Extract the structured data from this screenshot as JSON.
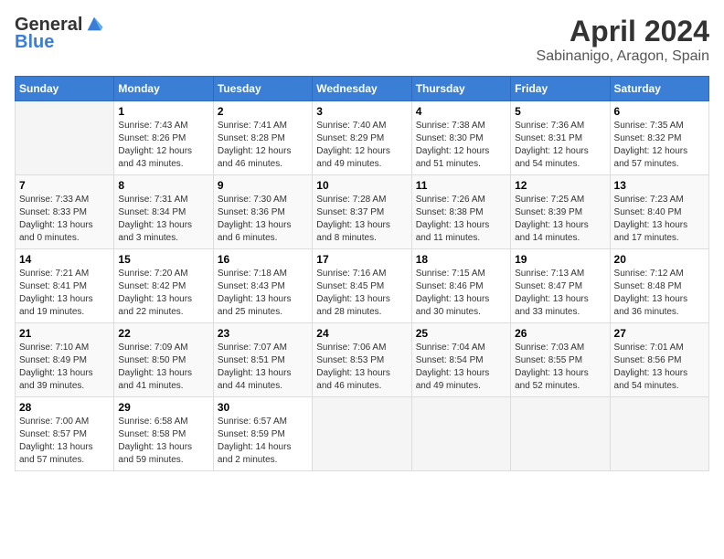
{
  "header": {
    "logo_line1": "General",
    "logo_line2": "Blue",
    "title": "April 2024",
    "subtitle": "Sabinanigo, Aragon, Spain"
  },
  "weekdays": [
    "Sunday",
    "Monday",
    "Tuesday",
    "Wednesday",
    "Thursday",
    "Friday",
    "Saturday"
  ],
  "weeks": [
    [
      {
        "day": "",
        "sunrise": "",
        "sunset": "",
        "daylight": ""
      },
      {
        "day": "1",
        "sunrise": "Sunrise: 7:43 AM",
        "sunset": "Sunset: 8:26 PM",
        "daylight": "Daylight: 12 hours and 43 minutes."
      },
      {
        "day": "2",
        "sunrise": "Sunrise: 7:41 AM",
        "sunset": "Sunset: 8:28 PM",
        "daylight": "Daylight: 12 hours and 46 minutes."
      },
      {
        "day": "3",
        "sunrise": "Sunrise: 7:40 AM",
        "sunset": "Sunset: 8:29 PM",
        "daylight": "Daylight: 12 hours and 49 minutes."
      },
      {
        "day": "4",
        "sunrise": "Sunrise: 7:38 AM",
        "sunset": "Sunset: 8:30 PM",
        "daylight": "Daylight: 12 hours and 51 minutes."
      },
      {
        "day": "5",
        "sunrise": "Sunrise: 7:36 AM",
        "sunset": "Sunset: 8:31 PM",
        "daylight": "Daylight: 12 hours and 54 minutes."
      },
      {
        "day": "6",
        "sunrise": "Sunrise: 7:35 AM",
        "sunset": "Sunset: 8:32 PM",
        "daylight": "Daylight: 12 hours and 57 minutes."
      }
    ],
    [
      {
        "day": "7",
        "sunrise": "Sunrise: 7:33 AM",
        "sunset": "Sunset: 8:33 PM",
        "daylight": "Daylight: 13 hours and 0 minutes."
      },
      {
        "day": "8",
        "sunrise": "Sunrise: 7:31 AM",
        "sunset": "Sunset: 8:34 PM",
        "daylight": "Daylight: 13 hours and 3 minutes."
      },
      {
        "day": "9",
        "sunrise": "Sunrise: 7:30 AM",
        "sunset": "Sunset: 8:36 PM",
        "daylight": "Daylight: 13 hours and 6 minutes."
      },
      {
        "day": "10",
        "sunrise": "Sunrise: 7:28 AM",
        "sunset": "Sunset: 8:37 PM",
        "daylight": "Daylight: 13 hours and 8 minutes."
      },
      {
        "day": "11",
        "sunrise": "Sunrise: 7:26 AM",
        "sunset": "Sunset: 8:38 PM",
        "daylight": "Daylight: 13 hours and 11 minutes."
      },
      {
        "day": "12",
        "sunrise": "Sunrise: 7:25 AM",
        "sunset": "Sunset: 8:39 PM",
        "daylight": "Daylight: 13 hours and 14 minutes."
      },
      {
        "day": "13",
        "sunrise": "Sunrise: 7:23 AM",
        "sunset": "Sunset: 8:40 PM",
        "daylight": "Daylight: 13 hours and 17 minutes."
      }
    ],
    [
      {
        "day": "14",
        "sunrise": "Sunrise: 7:21 AM",
        "sunset": "Sunset: 8:41 PM",
        "daylight": "Daylight: 13 hours and 19 minutes."
      },
      {
        "day": "15",
        "sunrise": "Sunrise: 7:20 AM",
        "sunset": "Sunset: 8:42 PM",
        "daylight": "Daylight: 13 hours and 22 minutes."
      },
      {
        "day": "16",
        "sunrise": "Sunrise: 7:18 AM",
        "sunset": "Sunset: 8:43 PM",
        "daylight": "Daylight: 13 hours and 25 minutes."
      },
      {
        "day": "17",
        "sunrise": "Sunrise: 7:16 AM",
        "sunset": "Sunset: 8:45 PM",
        "daylight": "Daylight: 13 hours and 28 minutes."
      },
      {
        "day": "18",
        "sunrise": "Sunrise: 7:15 AM",
        "sunset": "Sunset: 8:46 PM",
        "daylight": "Daylight: 13 hours and 30 minutes."
      },
      {
        "day": "19",
        "sunrise": "Sunrise: 7:13 AM",
        "sunset": "Sunset: 8:47 PM",
        "daylight": "Daylight: 13 hours and 33 minutes."
      },
      {
        "day": "20",
        "sunrise": "Sunrise: 7:12 AM",
        "sunset": "Sunset: 8:48 PM",
        "daylight": "Daylight: 13 hours and 36 minutes."
      }
    ],
    [
      {
        "day": "21",
        "sunrise": "Sunrise: 7:10 AM",
        "sunset": "Sunset: 8:49 PM",
        "daylight": "Daylight: 13 hours and 39 minutes."
      },
      {
        "day": "22",
        "sunrise": "Sunrise: 7:09 AM",
        "sunset": "Sunset: 8:50 PM",
        "daylight": "Daylight: 13 hours and 41 minutes."
      },
      {
        "day": "23",
        "sunrise": "Sunrise: 7:07 AM",
        "sunset": "Sunset: 8:51 PM",
        "daylight": "Daylight: 13 hours and 44 minutes."
      },
      {
        "day": "24",
        "sunrise": "Sunrise: 7:06 AM",
        "sunset": "Sunset: 8:53 PM",
        "daylight": "Daylight: 13 hours and 46 minutes."
      },
      {
        "day": "25",
        "sunrise": "Sunrise: 7:04 AM",
        "sunset": "Sunset: 8:54 PM",
        "daylight": "Daylight: 13 hours and 49 minutes."
      },
      {
        "day": "26",
        "sunrise": "Sunrise: 7:03 AM",
        "sunset": "Sunset: 8:55 PM",
        "daylight": "Daylight: 13 hours and 52 minutes."
      },
      {
        "day": "27",
        "sunrise": "Sunrise: 7:01 AM",
        "sunset": "Sunset: 8:56 PM",
        "daylight": "Daylight: 13 hours and 54 minutes."
      }
    ],
    [
      {
        "day": "28",
        "sunrise": "Sunrise: 7:00 AM",
        "sunset": "Sunset: 8:57 PM",
        "daylight": "Daylight: 13 hours and 57 minutes."
      },
      {
        "day": "29",
        "sunrise": "Sunrise: 6:58 AM",
        "sunset": "Sunset: 8:58 PM",
        "daylight": "Daylight: 13 hours and 59 minutes."
      },
      {
        "day": "30",
        "sunrise": "Sunrise: 6:57 AM",
        "sunset": "Sunset: 8:59 PM",
        "daylight": "Daylight: 14 hours and 2 minutes."
      },
      {
        "day": "",
        "sunrise": "",
        "sunset": "",
        "daylight": ""
      },
      {
        "day": "",
        "sunrise": "",
        "sunset": "",
        "daylight": ""
      },
      {
        "day": "",
        "sunrise": "",
        "sunset": "",
        "daylight": ""
      },
      {
        "day": "",
        "sunrise": "",
        "sunset": "",
        "daylight": ""
      }
    ]
  ]
}
